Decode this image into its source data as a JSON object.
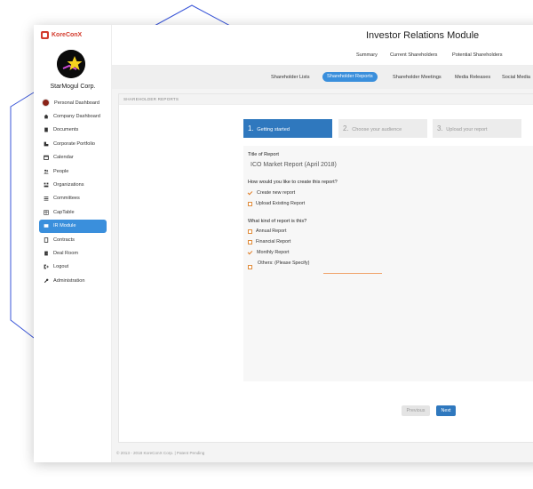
{
  "brand": {
    "name": "KoreConX"
  },
  "company": {
    "name": "StarMogul Corp."
  },
  "sidebar": {
    "items": [
      {
        "label": "Personal Dashboard",
        "icon": "user-avatar"
      },
      {
        "label": "Company Dashboard",
        "icon": "home-icon"
      },
      {
        "label": "Documents",
        "icon": "documents-icon"
      },
      {
        "label": "Corporate Portfolio",
        "icon": "portfolio-icon"
      },
      {
        "label": "Calendar",
        "icon": "calendar-icon"
      },
      {
        "label": "People",
        "icon": "people-icon"
      },
      {
        "label": "Organizations",
        "icon": "organizations-icon"
      },
      {
        "label": "Committees",
        "icon": "committees-icon"
      },
      {
        "label": "CapTable",
        "icon": "captable-icon"
      },
      {
        "label": "IR Module",
        "icon": "ir-icon",
        "active": true
      },
      {
        "label": "Contracts",
        "icon": "contracts-icon"
      },
      {
        "label": "Deal Room",
        "icon": "deal-room-icon"
      },
      {
        "label": "Logout",
        "icon": "logout-icon"
      },
      {
        "label": "Administration",
        "icon": "wrench-icon"
      }
    ]
  },
  "header": {
    "title": "Investor Relations Module"
  },
  "topnav": {
    "items": [
      "Summary",
      "Current Shareholders",
      "Potential Shareholders"
    ]
  },
  "subnav": {
    "items": [
      "Shareholder Lists",
      "Shareholder Reports",
      "Shareholder Meetings",
      "Media Releases",
      "Social Media"
    ],
    "active": "Shareholder Reports"
  },
  "panel": {
    "header": "SHAREHOLDER REPORTS"
  },
  "steps": [
    {
      "num": "1.",
      "label": "Getting started"
    },
    {
      "num": "2.",
      "label": "Choose your audience"
    },
    {
      "num": "3.",
      "label": "Upload your report"
    }
  ],
  "form": {
    "title_label": "Title of Report",
    "title_value": "ICO Market Report (April 2018)",
    "create_question": "How would you like to create this report?",
    "create_options": [
      {
        "label": "Create new report",
        "checked": true
      },
      {
        "label": "Upload Existing Report",
        "checked": false
      }
    ],
    "kind_question": "What kind of report is this?",
    "kind_options": [
      {
        "label": "Annual Report",
        "checked": false
      },
      {
        "label": "Financial Report",
        "checked": false
      },
      {
        "label": "Monthly Report",
        "checked": true
      }
    ],
    "other_label": "Others: (Please Specify)"
  },
  "buttons": {
    "previous": "Previous",
    "next": "Next"
  },
  "footer": {
    "text": "© 2013 - 2018 KoreConX Corp. | Patent Pending"
  },
  "colors": {
    "accent": "#3a8fdc",
    "active_step": "#2f78be",
    "check": "#e07b22",
    "brand": "#d33a2c",
    "decor_line": "#3a56d8"
  }
}
